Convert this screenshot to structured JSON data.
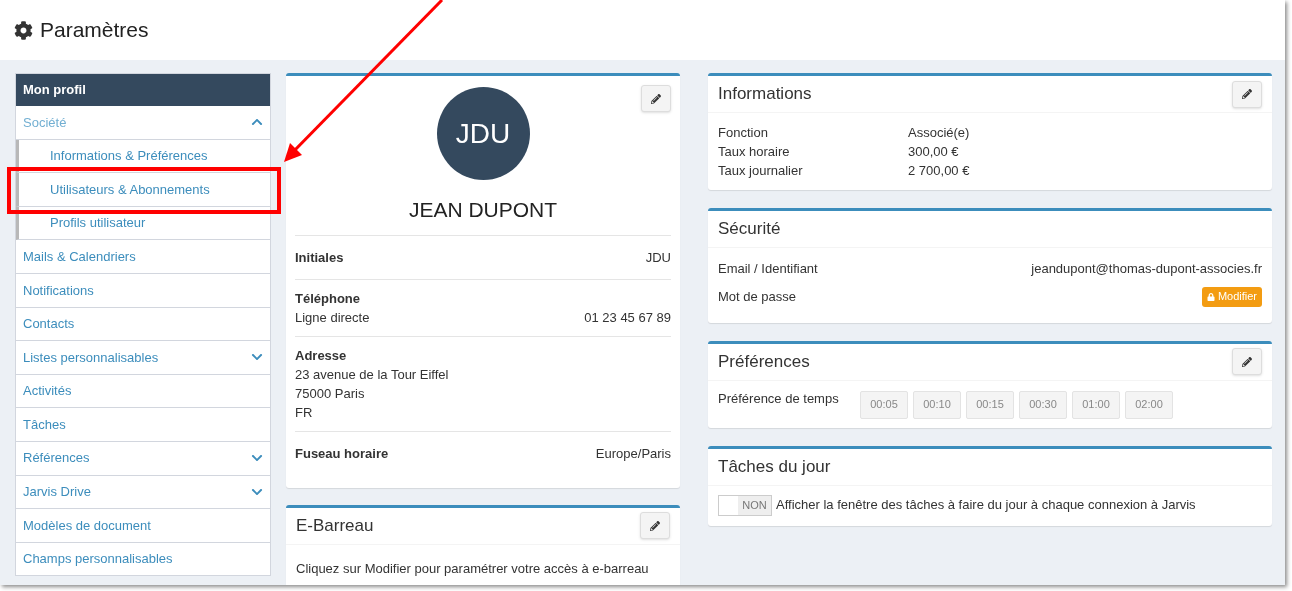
{
  "page_title": "Paramètres",
  "sidebar": {
    "header": "Mon profil",
    "items": [
      {
        "label": "Société",
        "expanded": true,
        "children": [
          {
            "label": "Informations & Préférences"
          },
          {
            "label": "Utilisateurs & Abonnements"
          },
          {
            "label": "Profils utilisateur"
          }
        ]
      },
      {
        "label": "Mails & Calendriers"
      },
      {
        "label": "Notifications"
      },
      {
        "label": "Contacts"
      },
      {
        "label": "Listes personnalisables",
        "expanded": false
      },
      {
        "label": "Activités"
      },
      {
        "label": "Tâches"
      },
      {
        "label": "Références",
        "expanded": false
      },
      {
        "label": "Jarvis Drive",
        "expanded": false
      },
      {
        "label": "Modèles de document"
      },
      {
        "label": "Champs personnalisables"
      }
    ]
  },
  "profile": {
    "avatar": "JDU",
    "name": "JEAN DUPONT",
    "sections": [
      {
        "title": "Initiales",
        "value": "JDU"
      },
      {
        "title": "Téléphone",
        "rows": [
          {
            "label": "Ligne directe",
            "value": "01 23 45 67 89"
          }
        ]
      },
      {
        "title": "Adresse",
        "lines": [
          "23 avenue de la Tour Eiffel",
          "75000 Paris",
          "FR"
        ]
      },
      {
        "title": "Fuseau horaire",
        "value": "Europe/Paris"
      }
    ]
  },
  "ebarreau": {
    "title": "E-Barreau",
    "text": "Cliquez sur Modifier pour paramétrer votre accès à e-barreau"
  },
  "informations": {
    "title": "Informations",
    "rows": [
      {
        "label": "Fonction",
        "value": "Associé(e)"
      },
      {
        "label": "Taux horaire",
        "value": "300,00 €"
      },
      {
        "label": "Taux journalier",
        "value": "2 700,00 €"
      }
    ]
  },
  "securite": {
    "title": "Sécurité",
    "email_label": "Email / Identifiant",
    "email": "jeandupont@thomas-dupont-associes.fr",
    "password_label": "Mot de passe",
    "button": "Modifier"
  },
  "preferences": {
    "title": "Préférences",
    "label": "Préférence de temps",
    "options": [
      {
        "label": "00:05",
        "selected": false
      },
      {
        "label": "00:10",
        "selected": false
      },
      {
        "label": "00:15",
        "selected": false
      },
      {
        "label": "00:30",
        "selected": false
      },
      {
        "label": "01:00",
        "selected": false
      },
      {
        "label": "02:00",
        "selected": false
      }
    ]
  },
  "taches": {
    "title": "Tâches du jour",
    "toggle": {
      "on": false,
      "label": "NON"
    },
    "text": "Afficher la fenêtre des tâches à faire du jour à chaque connexion à Jarvis"
  }
}
